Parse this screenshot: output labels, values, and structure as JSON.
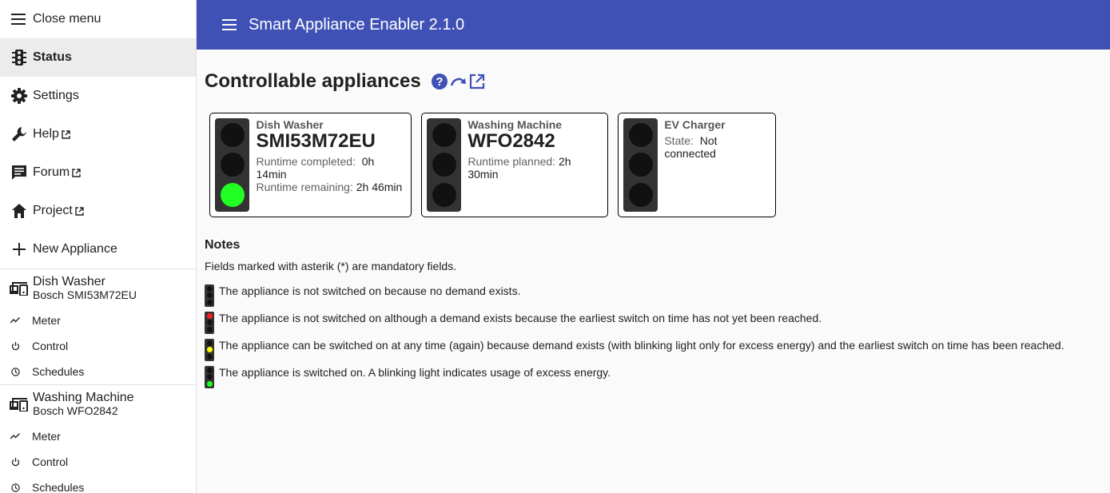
{
  "sidebar": {
    "close_menu": "Close menu",
    "items": [
      {
        "label": "Status",
        "icon": "traffic-light-icon",
        "external": false,
        "active": true
      },
      {
        "label": "Settings",
        "icon": "gear-icon",
        "external": false,
        "active": false
      },
      {
        "label": "Help",
        "icon": "wrench-icon",
        "external": true,
        "active": false
      },
      {
        "label": "Forum",
        "icon": "forum-icon",
        "external": true,
        "active": false
      },
      {
        "label": "Project",
        "icon": "home-icon",
        "external": true,
        "active": false
      }
    ],
    "new_appliance": "New Appliance",
    "appliances": [
      {
        "name": "Dish Washer",
        "model": "Bosch SMI53M72EU",
        "links": [
          "Meter",
          "Control",
          "Schedules"
        ]
      },
      {
        "name": "Washing Machine",
        "model": "Bosch WFO2842",
        "links": [
          "Meter",
          "Control",
          "Schedules"
        ]
      }
    ]
  },
  "topbar": {
    "title": "Smart Appliance Enabler 2.1.0",
    "color": "#3f51b5"
  },
  "main": {
    "title": "Controllable appliances",
    "icons": [
      "help-icon",
      "redirect-icon",
      "open-external-icon"
    ],
    "cards": [
      {
        "name": "Dish Washer",
        "model": "SMI53M72EU",
        "light": "green",
        "lines": [
          {
            "label": "Runtime completed:",
            "value": "0h 14min"
          },
          {
            "label": "Runtime remaining:",
            "value": "2h 46min"
          }
        ]
      },
      {
        "name": "Washing Machine",
        "model": "WFO2842",
        "light": "off",
        "lines": [
          {
            "label": "Runtime planned:",
            "value": "2h 30min"
          }
        ]
      },
      {
        "name": "EV Charger",
        "state_label": "State:",
        "state_value": "Not connected",
        "light": "off"
      }
    ],
    "notes": {
      "title": "Notes",
      "mandatory": "Fields marked with asterik (*) are mandatory fields.",
      "legend": [
        {
          "light": "off",
          "text": "The appliance is not switched on because no demand exists."
        },
        {
          "light": "red",
          "text": "The appliance is not switched on although a demand exists because the earliest switch on time has not yet been reached."
        },
        {
          "light": "yellow",
          "text": "The appliance can be switched on at any time (again) because demand exists (with blinking light only for excess energy) and the earliest switch on time has been reached."
        },
        {
          "light": "green",
          "text": "The appliance is switched on. A blinking light indicates usage of excess energy."
        }
      ]
    }
  }
}
